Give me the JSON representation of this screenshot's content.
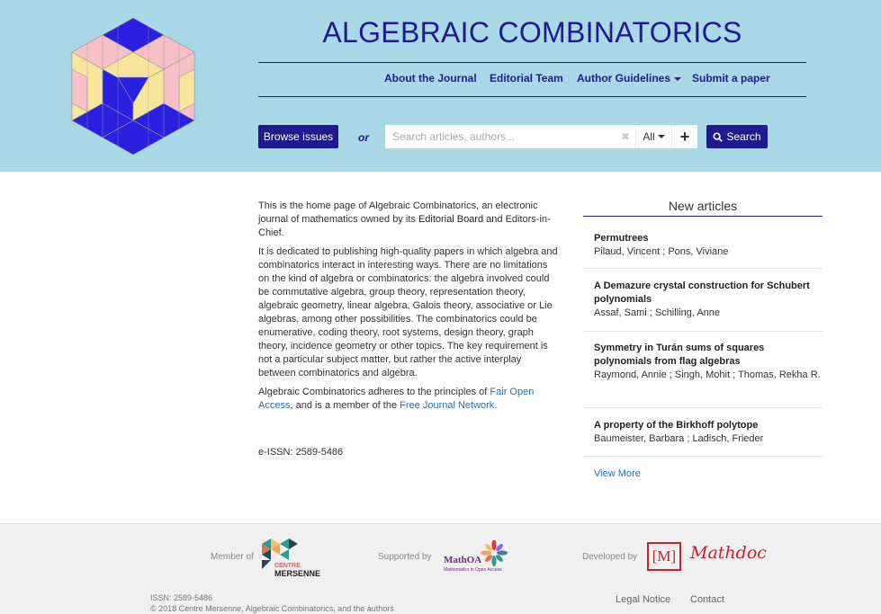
{
  "header": {
    "title": "ALGEBRAIC COMBINATORICS",
    "nav": [
      {
        "label": "About the Journal"
      },
      {
        "label": "Editorial Team"
      },
      {
        "label": "Author Guidelines"
      },
      {
        "label": "Submit a paper"
      }
    ],
    "browse_label": "Browse issues",
    "or_label": "or",
    "search": {
      "placeholder": "Search articles, authors...",
      "value": "",
      "scope": "All",
      "button_label": "Search"
    }
  },
  "main": {
    "intro": "This is the home page of Algebraic Combinatorics, an electronic journal of mathematics owned by its",
    "intro_bold": "Editorial Board and",
    "intro_end": "Editors-in-Chief.",
    "paragraph2": "It is dedicated to publishing high-quality papers in which algebra and combinatorics interact in interesting ways. There are no limitations on the kind of algebra or combinatorics: the algebra involved could be commutative algebra, group theory, representation theory, algebraic geometry, linear algebra, Galois theory, associative or Lie algebras, among other possibilities. The combinatorics could be enumerative, coding theory, root systems, design theory, graph theory, incidence geometry or other topics. The key requirement is not a particular subject matter, but rather the active interplay between combinatorics and algebra.",
    "p3_start": "Algebraic Combinatorics adheres to the principles of",
    "p3_link1": "Fair Open Access",
    "p3_mid": ", and is a member of the",
    "p3_link2": "Free Journal Network",
    "p3_end": ".",
    "issn": "e-ISSN: 2589-5486"
  },
  "new_articles": {
    "title": "New articles",
    "items": [
      {
        "title": "Permutrees",
        "authors": "Pilaud, Vincent ; Pons, Viviane"
      },
      {
        "title": "A Demazure crystal construction for Schubert polynomials",
        "authors": "Assaf, Sami ; Schilling, Anne"
      },
      {
        "title": "Symmetry in Turán sums of squares polynomials from flag algebras",
        "authors": "Raymond, Annie ; Singh, Mohit ; Thomas, Rekha R."
      },
      {
        "title": "A property of the Birkhoff polytope",
        "authors": "Baumeister, Barbara ; Ladisch, Frieder"
      }
    ],
    "view_more": "View More"
  },
  "footer": {
    "member_of": "Member of",
    "mersenne_top": "CENTRE",
    "mersenne_bottom": "MERSENNE",
    "supported_by": "Supported by",
    "mathoa_name": "MathOA",
    "mathoa_sub": "Mathematics in Open Access",
    "developed_by": "Developed by",
    "mathdoc_box": "[M]",
    "mathdoc_name": "Mathdoc",
    "issn": "ISSN: 2589-5486",
    "copyright": "© 2018 Centre Mersenne, Algebraic Combinatorics, and the authors",
    "legal": "Legal Notice",
    "contact": "Contact"
  },
  "colors": {
    "header_bg": "#a9d9e6",
    "brand": "#1f1a8f",
    "link": "#2a6ebb",
    "mathdoc_red": "#c8202f"
  },
  "icons": [
    "journal-logo",
    "clear-icon",
    "chevron-down-icon",
    "plus-icon",
    "search-icon",
    "centre-mersenne-logo",
    "mathoa-logo",
    "mathdoc-logo"
  ]
}
